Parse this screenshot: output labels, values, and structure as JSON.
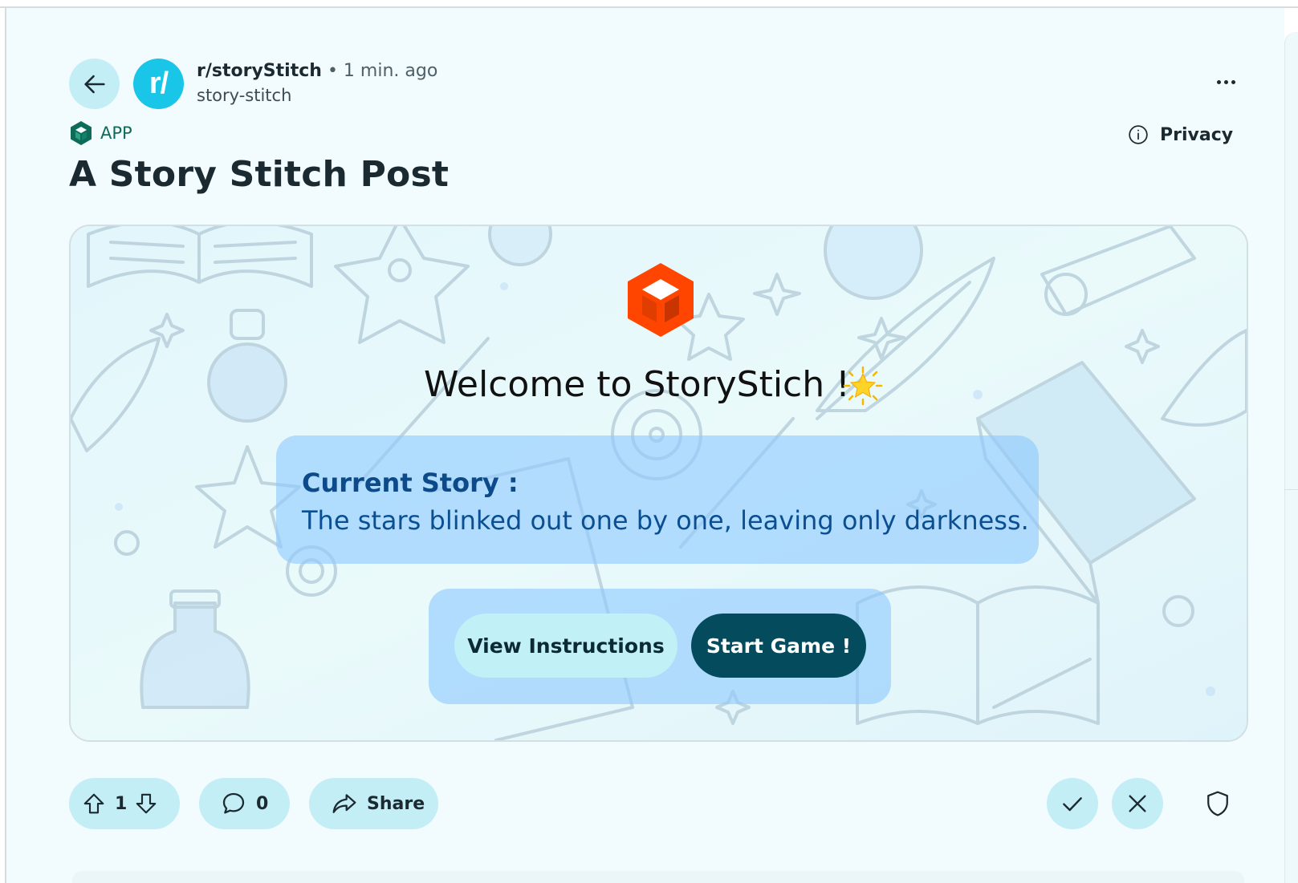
{
  "header": {
    "subreddit_name": "r/storyStitch",
    "separator": "•",
    "time_ago": "1 min. ago",
    "author": "story-stitch",
    "avatar_text": "r/",
    "back_icon": "arrow-left-icon",
    "more_icon": "more-horizontal-icon"
  },
  "badge": {
    "label": "APP",
    "icon": "app-cube-icon",
    "color": "#0f6b59"
  },
  "privacy": {
    "label": "Privacy",
    "icon": "info-icon"
  },
  "post": {
    "title": "A Story Stitch Post"
  },
  "app": {
    "logo_icon": "storystitch-logo-icon",
    "logo_color": "#ff4500",
    "welcome_text": "Welcome to StoryStich !",
    "welcome_emoji": "glowing-star-emoji",
    "current_story_label": "Current Story :",
    "current_story_text": "The stars blinked out one by one, leaving only darkness.",
    "buttons": {
      "instructions_label": "View Instructions",
      "start_label": "Start Game !"
    },
    "accent_dark": "#044b5d"
  },
  "actions": {
    "vote_count": "1",
    "comment_count": "0",
    "share_label": "Share",
    "upvote_icon": "arrow-up-icon",
    "downvote_icon": "arrow-down-icon",
    "comment_icon": "comment-bubble-icon",
    "share_icon": "share-arrow-icon",
    "approve_icon": "checkmark-icon",
    "remove_icon": "close-icon",
    "mod_icon": "shield-icon",
    "pill_color": "#c3eef6"
  }
}
